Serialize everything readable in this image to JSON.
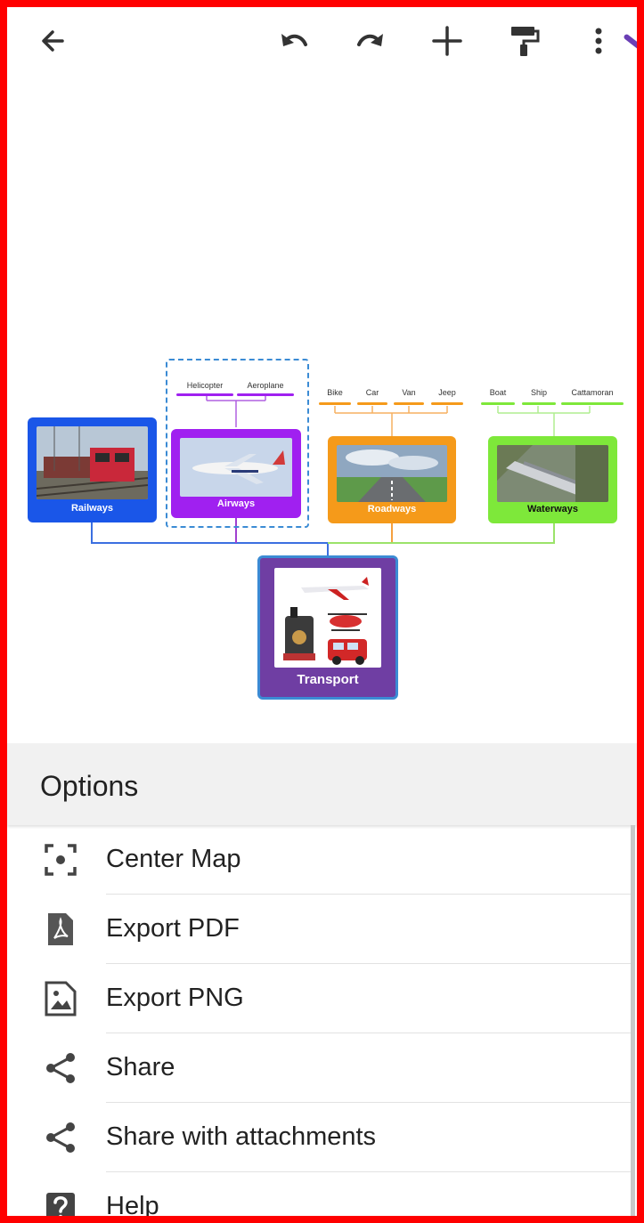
{
  "toolbar": {
    "back_icon": "back-arrow-icon",
    "undo_icon": "undo-icon",
    "redo_icon": "redo-icon",
    "add_icon": "plus-icon",
    "style_icon": "paint-roller-icon",
    "more_icon": "more-vert-icon"
  },
  "mindmap": {
    "root": {
      "label": "Transport",
      "color": "#6f3ea3",
      "border": "#3b8bd4"
    },
    "branches": [
      {
        "label": "Railways",
        "color": "#1a56e8",
        "image": "train-photo",
        "children": []
      },
      {
        "label": "Airways",
        "color": "#a020f0",
        "image": "airplane-photo",
        "children": [
          "Helicopter",
          "Aeroplane"
        ]
      },
      {
        "label": "Roadways",
        "color": "#f59a1a",
        "image": "road-photo",
        "children": [
          "Bike",
          "Car",
          "Van",
          "Jeep"
        ]
      },
      {
        "label": "Waterways",
        "color": "#7ee83a",
        "image": "ship-photo",
        "children": [
          "Boat",
          "Ship",
          "Cattamoran"
        ]
      }
    ]
  },
  "options": {
    "title": "Options",
    "items": [
      {
        "label": "Center Map",
        "icon": "center-focus-icon"
      },
      {
        "label": "Export PDF",
        "icon": "pdf-icon"
      },
      {
        "label": "Export PNG",
        "icon": "image-icon"
      },
      {
        "label": "Share",
        "icon": "share-icon"
      },
      {
        "label": "Share with attachments",
        "icon": "share-icon"
      },
      {
        "label": "Help",
        "icon": "help-icon"
      }
    ]
  }
}
